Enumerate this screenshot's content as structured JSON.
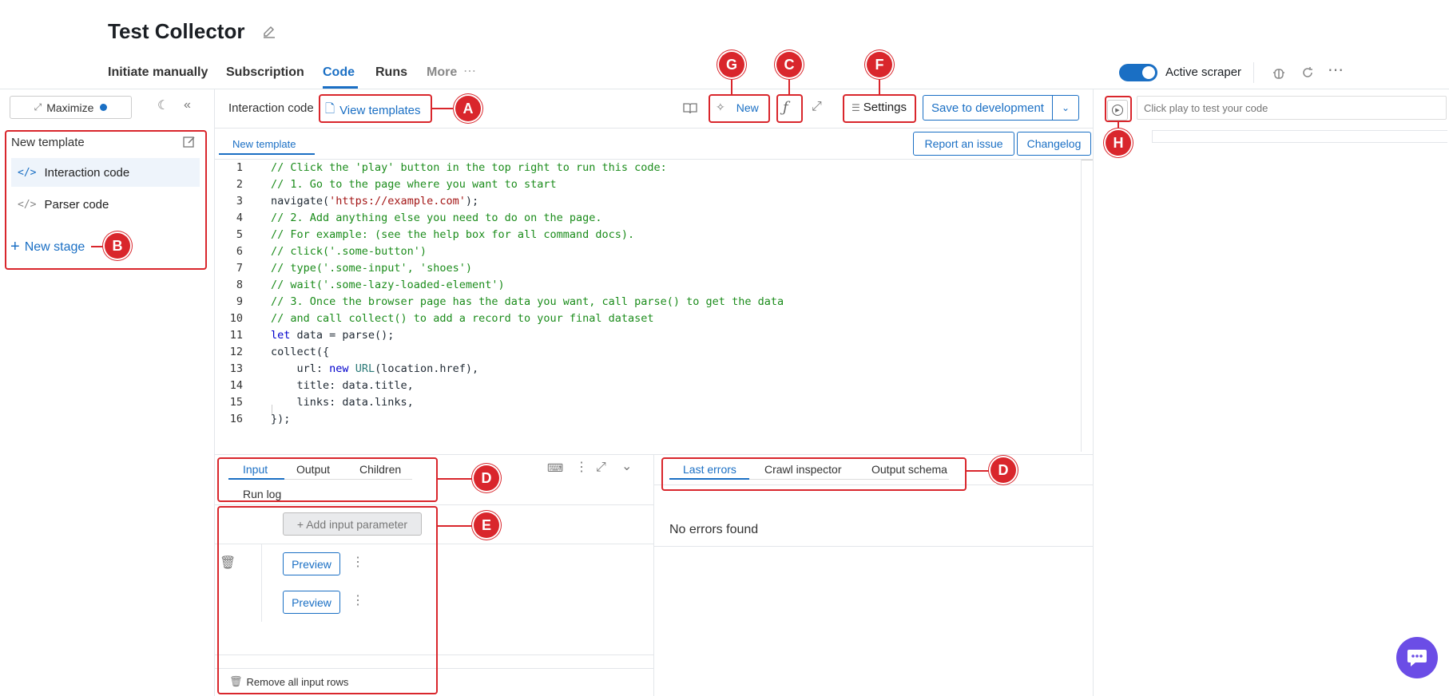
{
  "header": {
    "title": "Test Collector",
    "tabs": [
      {
        "label": "Initiate manually"
      },
      {
        "label": "Subscription"
      },
      {
        "label": "Code"
      },
      {
        "label": "Runs"
      },
      {
        "label": "More"
      }
    ],
    "active_toggle_label": "Active scraper"
  },
  "sidebar": {
    "maximize_label": "Maximize",
    "template_name": "New template",
    "items": [
      {
        "label": "Interaction code"
      },
      {
        "label": "Parser code"
      }
    ],
    "new_stage_label": "New stage"
  },
  "editor": {
    "interaction_code_label": "Interaction code",
    "view_templates_label": "View templates",
    "new_label": "New",
    "settings_label": "Settings",
    "save_label": "Save to development",
    "tab_label": "New template",
    "report_label": "Report an issue",
    "changelog_label": "Changelog",
    "code_lines": [
      "// Click the 'play' button in the top right to run this code:",
      "// 1. Go to the page where you want to start",
      "navigate('https://example.com');",
      "// 2. Add anything else you need to do on the page.",
      "// For example: (see the help box for all command docs).",
      "// click('.some-button')",
      "// type('.some-input', 'shoes')",
      "// wait('.some-lazy-loaded-element')",
      "// 3. Once the browser page has the data you want, call parse() to get the data",
      "// and call collect() to add a record to your final dataset",
      "let data = parse();",
      "collect({",
      "    url: new URL(location.href),",
      "    title: data.title,",
      "    links: data.links,",
      "});"
    ]
  },
  "input_panel": {
    "tabs": [
      {
        "label": "Input"
      },
      {
        "label": "Output"
      },
      {
        "label": "Children"
      },
      {
        "label": "Run log"
      }
    ],
    "add_param_label": "+ Add input parameter",
    "preview_label": "Preview",
    "remove_all_label": "Remove all input rows"
  },
  "errors_panel": {
    "tabs": [
      {
        "label": "Last errors"
      },
      {
        "label": "Crawl inspector"
      },
      {
        "label": "Output schema"
      }
    ],
    "empty_text": "No errors found"
  },
  "preview": {
    "url_placeholder": "Click play to test your code"
  },
  "annotations": [
    "A",
    "B",
    "C",
    "D",
    "D",
    "E",
    "F",
    "G",
    "H"
  ],
  "colors": {
    "accent": "#1a6fc4",
    "annotation": "#d9262c",
    "chat": "#6b4de6"
  }
}
